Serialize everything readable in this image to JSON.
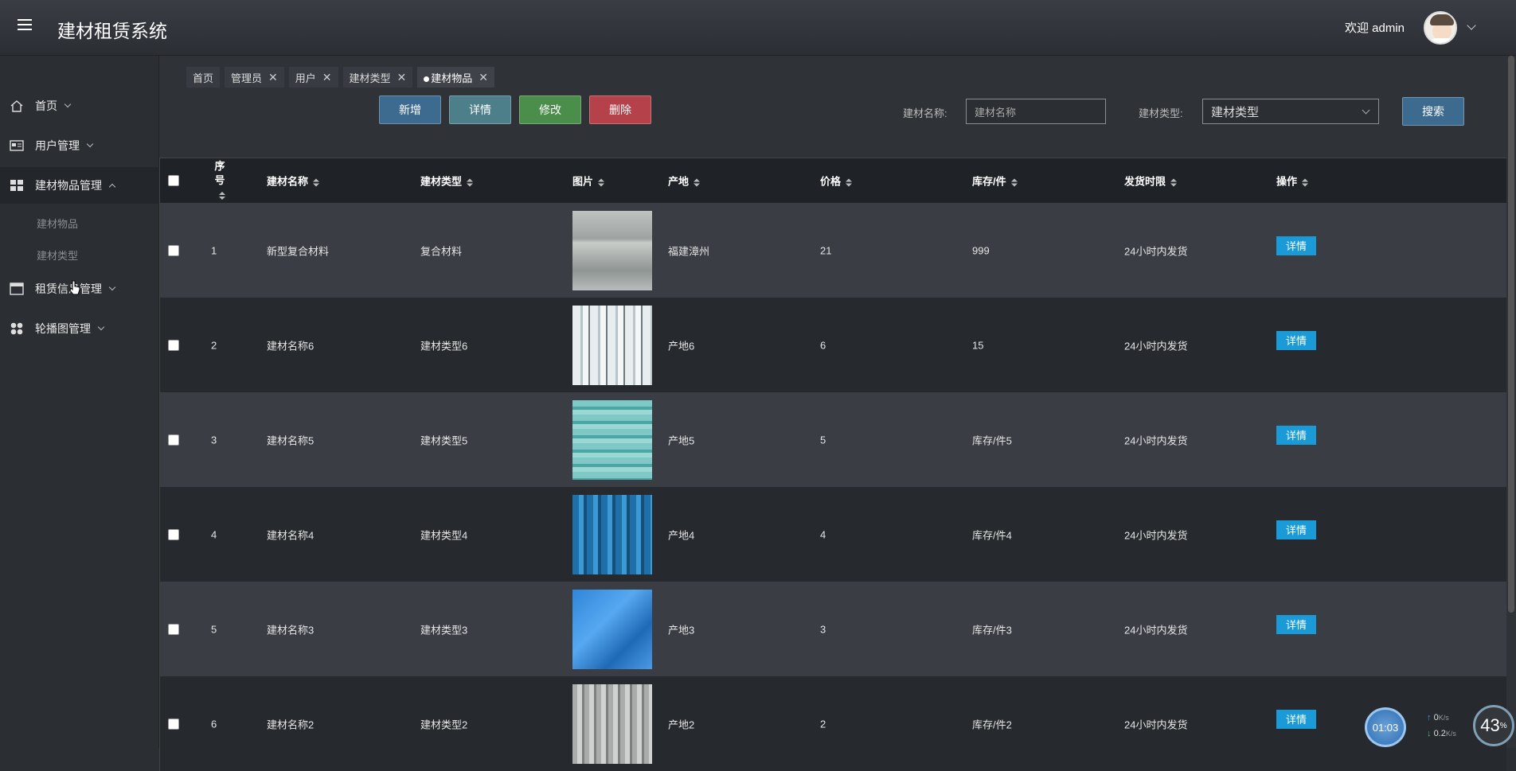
{
  "header": {
    "title": "建材租赁系统",
    "welcome": "欢迎 admin"
  },
  "sidebar": {
    "items": [
      {
        "label": "首页",
        "icon": "home-icon"
      },
      {
        "label": "用户管理",
        "icon": "user-card-icon"
      },
      {
        "label": "建材物品管理",
        "icon": "grid-icon"
      },
      {
        "label": "租赁信息管理",
        "icon": "list-icon"
      },
      {
        "label": "轮播图管理",
        "icon": "dots-grid-icon"
      }
    ],
    "sub": [
      "建材物品",
      "建材类型"
    ]
  },
  "tabs": [
    {
      "label": "首页"
    },
    {
      "label": "管理员"
    },
    {
      "label": "用户"
    },
    {
      "label": "建材类型"
    },
    {
      "label": "建材物品"
    }
  ],
  "toolbar": {
    "add": "新增",
    "detail": "详情",
    "edit": "修改",
    "delete": "删除",
    "search": "搜索"
  },
  "filters": {
    "name_label": "建材名称:",
    "name_placeholder": "建材名称",
    "type_label": "建材类型:",
    "type_value": "建材类型"
  },
  "table": {
    "headers": [
      "序号",
      "建材名称",
      "建材类型",
      "图片",
      "产地",
      "价格",
      "库存/件",
      "发货时限",
      "操作"
    ],
    "action": "详情",
    "rows": [
      {
        "no": "1",
        "name": "新型复合材料",
        "type": "复合材料",
        "origin": "福建漳州",
        "price": "21",
        "stock": "999",
        "ship": "24小时内发货"
      },
      {
        "no": "2",
        "name": "建材名称6",
        "type": "建材类型6",
        "origin": "产地6",
        "price": "6",
        "stock": "15",
        "ship": "24小时内发货"
      },
      {
        "no": "3",
        "name": "建材名称5",
        "type": "建材类型5",
        "origin": "产地5",
        "price": "5",
        "stock": "库存/件5",
        "ship": "24小时内发货"
      },
      {
        "no": "4",
        "name": "建材名称4",
        "type": "建材类型4",
        "origin": "产地4",
        "price": "4",
        "stock": "库存/件4",
        "ship": "24小时内发货"
      },
      {
        "no": "5",
        "name": "建材名称3",
        "type": "建材类型3",
        "origin": "产地3",
        "price": "3",
        "stock": "库存/件3",
        "ship": "24小时内发货"
      },
      {
        "no": "6",
        "name": "建材名称2",
        "type": "建材类型2",
        "origin": "产地2",
        "price": "2",
        "stock": "库存/件2",
        "ship": "24小时内发货"
      }
    ]
  },
  "overlay": {
    "clock": "01:03",
    "up": "0",
    "down": "0.2",
    "unit": "K/s",
    "cpu": "43"
  }
}
